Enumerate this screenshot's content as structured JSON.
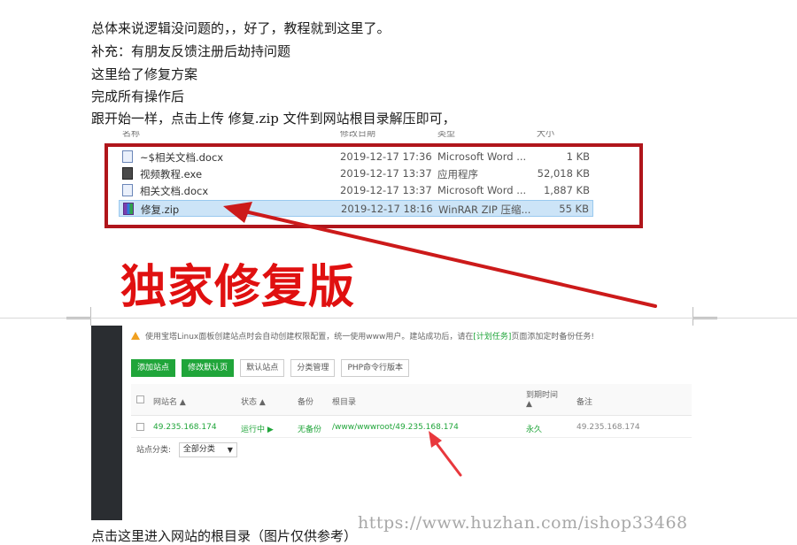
{
  "paragraphs": [
    "总体来说逻辑没问题的，，好了，教程就到这里了。",
    "补充：有朋友反馈注册后劫持问题",
    "这里给了修复方案",
    "完成所有操作后",
    "跟开始一样，点击上传  修复.zip   文件到网站根目录解压即可，"
  ],
  "explorer": {
    "headers": {
      "name": "名称",
      "date": "修改日期",
      "type": "类型",
      "size": "大小"
    },
    "files": [
      {
        "name": "~$相关文档.docx",
        "date": "2019-12-17 17:36",
        "type": "Microsoft Word ...",
        "size": "1 KB",
        "icon": "word-doc-icon"
      },
      {
        "name": "视频教程.exe",
        "date": "2019-12-17 13:37",
        "type": "应用程序",
        "size": "52,018 KB",
        "icon": "exe-icon"
      },
      {
        "name": "相关文档.docx",
        "date": "2019-12-17 13:37",
        "type": "Microsoft Word ...",
        "size": "1,887 KB",
        "icon": "word-doc-icon"
      },
      {
        "name": "修复.zip",
        "date": "2019-12-17 18:16",
        "type": "WinRAR ZIP 压缩...",
        "size": "55 KB",
        "icon": "winrar-zip-icon",
        "selected": true
      }
    ],
    "overlay_label": "独家修复版",
    "highlight_color": "#b0151b",
    "label_color": "#e01010"
  },
  "panel": {
    "notice_prefix": "使用宝塔Linux面板创建站点时会自动创建权限配置，统一使用www用户。建站成功后，请在",
    "notice_link": "[计划任务]",
    "notice_suffix": "页面添加定时备份任务!",
    "buttons": [
      "添加站点",
      "修改默认页",
      "默认站点",
      "分类管理",
      "PHP命令行版本"
    ],
    "columns": {
      "name": "网站名",
      "status": "状态",
      "backup": "备份",
      "root": "根目录",
      "expire": "到期时间",
      "note": "备注"
    },
    "row": {
      "name": "49.235.168.174",
      "status": "运行中 ▶",
      "backup": "无备份",
      "root": "/www/wwwroot/49.235.168.174",
      "expire": "永久",
      "note": "49.235.168.174"
    },
    "category_label": "站点分类:",
    "category_value": "全部分类",
    "accent_color": "#20a53a"
  },
  "footer_text": "点击这里进入网站的根目录（图片仅供参考）",
  "watermark": "https://www.huzhan.com/ishop33468"
}
